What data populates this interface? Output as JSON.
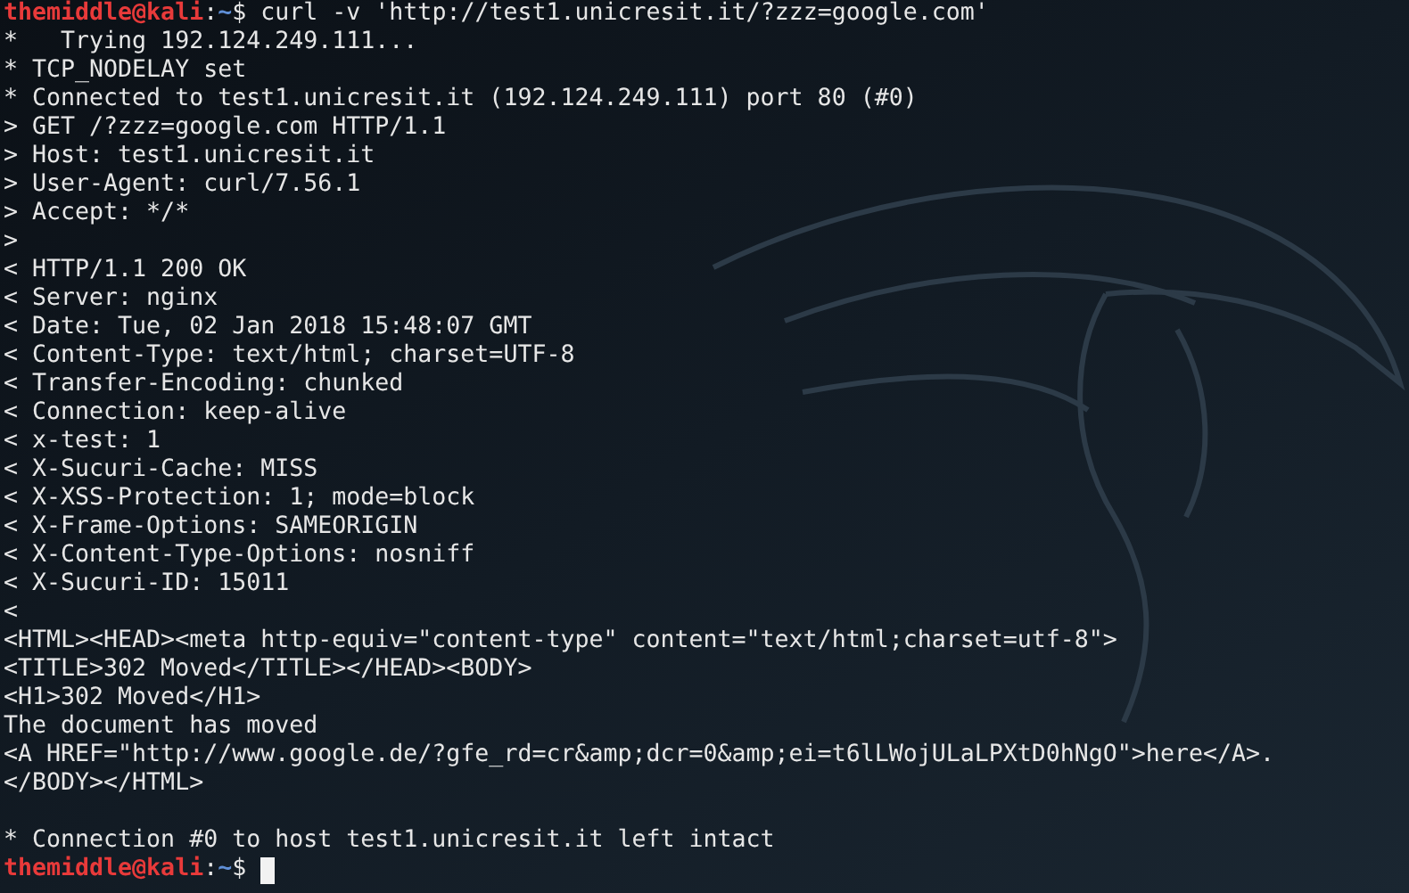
{
  "terminal": {
    "lines": [
      {
        "kind": "prompt",
        "user": "themiddle@kali",
        "sep": ":",
        "path": "~",
        "symbol": "$",
        "command": "curl -v 'http://test1.unicresit.it/?zzz=google.com'",
        "cursor": false
      },
      {
        "kind": "output",
        "text": "*   Trying 192.124.249.111..."
      },
      {
        "kind": "output",
        "text": "* TCP_NODELAY set"
      },
      {
        "kind": "output",
        "text": "* Connected to test1.unicresit.it (192.124.249.111) port 80 (#0)"
      },
      {
        "kind": "output",
        "text": "> GET /?zzz=google.com HTTP/1.1"
      },
      {
        "kind": "output",
        "text": "> Host: test1.unicresit.it"
      },
      {
        "kind": "output",
        "text": "> User-Agent: curl/7.56.1"
      },
      {
        "kind": "output",
        "text": "> Accept: */*"
      },
      {
        "kind": "output",
        "text": ">"
      },
      {
        "kind": "output",
        "text": "< HTTP/1.1 200 OK"
      },
      {
        "kind": "output",
        "text": "< Server: nginx"
      },
      {
        "kind": "output",
        "text": "< Date: Tue, 02 Jan 2018 15:48:07 GMT"
      },
      {
        "kind": "output",
        "text": "< Content-Type: text/html; charset=UTF-8"
      },
      {
        "kind": "output",
        "text": "< Transfer-Encoding: chunked"
      },
      {
        "kind": "output",
        "text": "< Connection: keep-alive"
      },
      {
        "kind": "output",
        "text": "< x-test: 1"
      },
      {
        "kind": "output",
        "text": "< X-Sucuri-Cache: MISS"
      },
      {
        "kind": "output",
        "text": "< X-XSS-Protection: 1; mode=block"
      },
      {
        "kind": "output",
        "text": "< X-Frame-Options: SAMEORIGIN"
      },
      {
        "kind": "output",
        "text": "< X-Content-Type-Options: nosniff"
      },
      {
        "kind": "output",
        "text": "< X-Sucuri-ID: 15011"
      },
      {
        "kind": "output",
        "text": "<"
      },
      {
        "kind": "output",
        "text": "<HTML><HEAD><meta http-equiv=\"content-type\" content=\"text/html;charset=utf-8\">"
      },
      {
        "kind": "output",
        "text": "<TITLE>302 Moved</TITLE></HEAD><BODY>"
      },
      {
        "kind": "output",
        "text": "<H1>302 Moved</H1>"
      },
      {
        "kind": "output",
        "text": "The document has moved"
      },
      {
        "kind": "output",
        "text": "<A HREF=\"http://www.google.de/?gfe_rd=cr&amp;dcr=0&amp;ei=t6lLWojULaLPXtD0hNgO\">here</A>."
      },
      {
        "kind": "output",
        "text": "</BODY></HTML>"
      },
      {
        "kind": "blank"
      },
      {
        "kind": "output",
        "text": "* Connection #0 to host test1.unicresit.it left intact"
      },
      {
        "kind": "prompt",
        "user": "themiddle@kali",
        "sep": ":",
        "path": "~",
        "symbol": "$",
        "cursor": true
      }
    ]
  }
}
